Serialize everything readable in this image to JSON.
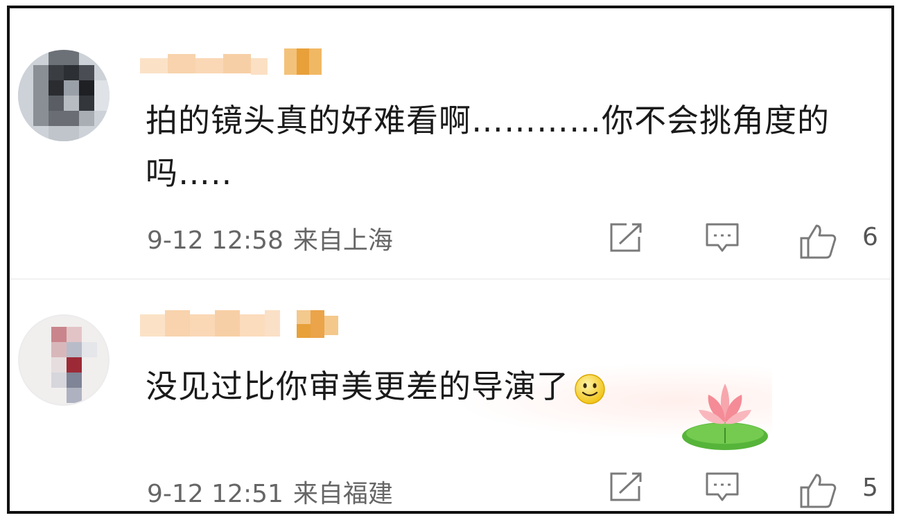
{
  "comments": [
    {
      "text": "拍的镜头真的好难看啊…………你不会挑角度的吗…..",
      "time": "9-12 12:58",
      "location": "来自上海",
      "likes": "6",
      "avatar_icon": "pixelated-avatar",
      "share_icon": "share-icon",
      "reply_icon": "comment-icon",
      "like_icon": "thumbs-up-icon"
    },
    {
      "text": "没见过比你审美更差的导演了",
      "time": "9-12 12:51",
      "location": "来自福建",
      "likes": "5",
      "emoji_icon": "smiley-icon",
      "sticker_icon": "lotus-icon",
      "avatar_icon": "pixelated-avatar",
      "share_icon": "share-icon",
      "reply_icon": "comment-icon",
      "like_icon": "thumbs-up-icon"
    }
  ],
  "colors": {
    "text": "#1a1a1a",
    "meta": "#666666",
    "name_blur": "#f5c99a",
    "badge": "#e8a03a"
  }
}
